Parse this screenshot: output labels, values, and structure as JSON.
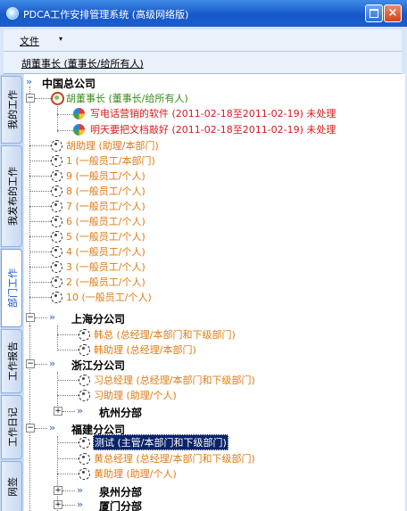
{
  "window": {
    "title": "PDCA工作安排管理系统 (高级网络版)",
    "close_glyph": "×"
  },
  "menu": {
    "file_label": "文件",
    "file_arrow": "▾"
  },
  "user": {
    "label": "胡董事长 (董事长/给所有人)"
  },
  "side_tabs": [
    "我的工作",
    "我发布的工作",
    "部门工作",
    "工作报告",
    "工作日记",
    "网签"
  ],
  "active_tab": "部门工作",
  "colors": {
    "title_bar": "#1758c9",
    "leader": "#3a8a1e",
    "task": "#d81b1b",
    "employee": "#e07a10",
    "selection": "#0a246a"
  },
  "tree": {
    "root": "中国总公司",
    "chairman": "胡董事长 (董事长/给所有人)",
    "tasks": [
      "写电话营销的软件 (2011-02-18至2011-02-19) 未处理",
      "明天要把文档敲好 (2011-02-18至2011-02-19) 未处理"
    ],
    "hq_staff": [
      "胡助理 (助理/本部门)",
      "1 (一般员工/本部门)",
      "9 (一般员工/个人)",
      "8 (一般员工/个人)",
      "7 (一般员工/个人)",
      "6 (一般员工/个人)",
      "5 (一般员工/个人)",
      "4 (一般员工/个人)",
      "3 (一般员工/个人)",
      "2 (一般员工/个人)",
      "10 (一般员工/个人)"
    ],
    "shanghai": {
      "name": "上海分公司",
      "staff": [
        "韩总 (总经理/本部门和下级部门)",
        "韩助理 (总经理/本部门)"
      ]
    },
    "zhejiang": {
      "name": "浙江分公司",
      "staff": [
        "习总经理 (总经理/本部门和下级部门)",
        "习助理 (助理/个人)"
      ],
      "sub": "杭州分部"
    },
    "fujian": {
      "name": "福建分公司",
      "staff": [
        "测试 (主管/本部门和下级部门)",
        "黄总经理 (总经理/本部门和下级部门)",
        "黄助理 (助理/个人)"
      ],
      "subs": [
        "泉州分部",
        "厦门分部"
      ]
    }
  }
}
